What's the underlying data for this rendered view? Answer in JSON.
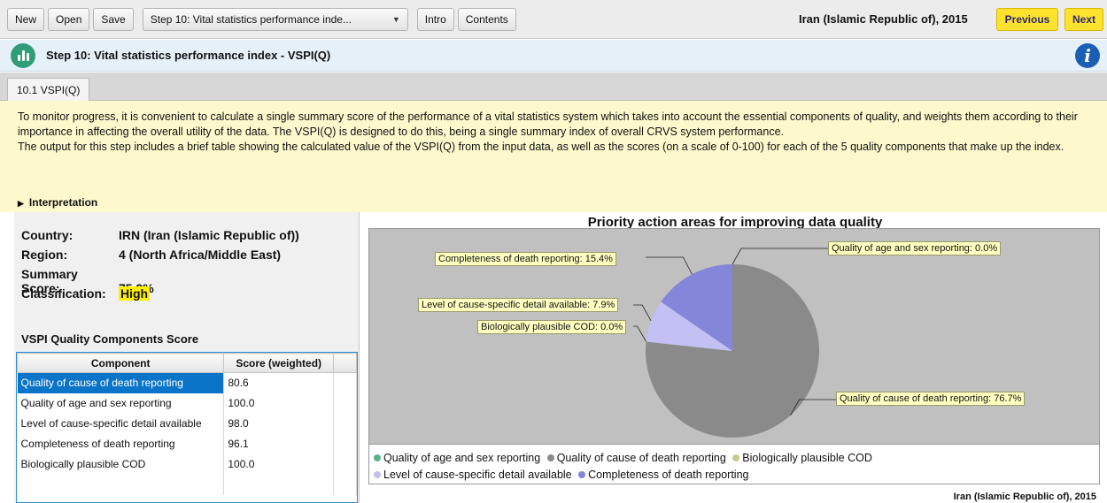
{
  "toolbar": {
    "new": "New",
    "open": "Open",
    "save": "Save",
    "step_select": "Step 10: Vital statistics performance inde...",
    "intro": "Intro",
    "contents": "Contents",
    "country_year": "Iran (Islamic Republic of), 2015",
    "previous": "Previous",
    "next": "Next"
  },
  "step": {
    "title": "Step 10: Vital statistics performance index - VSPI(Q)",
    "tab": "10.1 VSPI(Q)"
  },
  "description": {
    "p1": "To monitor progress, it is convenient to calculate a single summary score of the performance of a vital statistics system which takes into account the essential components of quality, and weights them according to their importance in affecting the overall utility of the data. The VSPI(Q) is designed to do this, being a single summary index of overall CRVS system performance.",
    "p2": "The output for this step includes a brief table showing the calculated value of the VSPI(Q) from the input data, as well as the scores (on a scale of 0-100) for each of the 5 quality components that make up the index.",
    "interpretation": "Interpretation"
  },
  "summary": {
    "country_label": "Country:",
    "country_value": "IRN (Iran (Islamic Republic of))",
    "region_label": "Region:",
    "region_value": "4 (North Africa/Middle East)",
    "score_label": "Summary Score:",
    "score_value": "75.9%",
    "class_label": "Classification:",
    "class_value": "High"
  },
  "components": {
    "title": "VSPI Quality Components Score",
    "headers": [
      "Component",
      "Score (weighted)"
    ],
    "rows": [
      {
        "name": "Quality of cause of death reporting",
        "score": "80.6"
      },
      {
        "name": "Quality of age and sex reporting",
        "score": "100.0"
      },
      {
        "name": "Level of cause-specific detail available",
        "score": "98.0"
      },
      {
        "name": "Completeness of death reporting",
        "score": "96.1"
      },
      {
        "name": "Biologically plausible COD",
        "score": "100.0"
      }
    ]
  },
  "chart_data": {
    "type": "pie",
    "title": "Priority action areas for improving data quality",
    "slices": [
      {
        "name": "Quality of age and sex reporting",
        "value": 0.0,
        "label": "Quality of age and sex reporting: 0.0%",
        "color": "#55b38a"
      },
      {
        "name": "Quality of cause of death reporting",
        "value": 76.7,
        "label": "Quality of cause of death reporting: 76.7%",
        "color": "#8a8a8a"
      },
      {
        "name": "Biologically plausible COD",
        "value": 0.0,
        "label": "Biologically plausible COD: 0.0%",
        "color": "#c9c98e"
      },
      {
        "name": "Level of cause-specific detail available",
        "value": 7.9,
        "label": "Level of cause-specific detail available: 7.9%",
        "color": "#c3c0f3"
      },
      {
        "name": "Completeness of death reporting",
        "value": 15.4,
        "label": "Completeness of death reporting: 15.4%",
        "color": "#8585d9"
      }
    ],
    "footer": "Iran (Islamic Republic of), 2015"
  }
}
